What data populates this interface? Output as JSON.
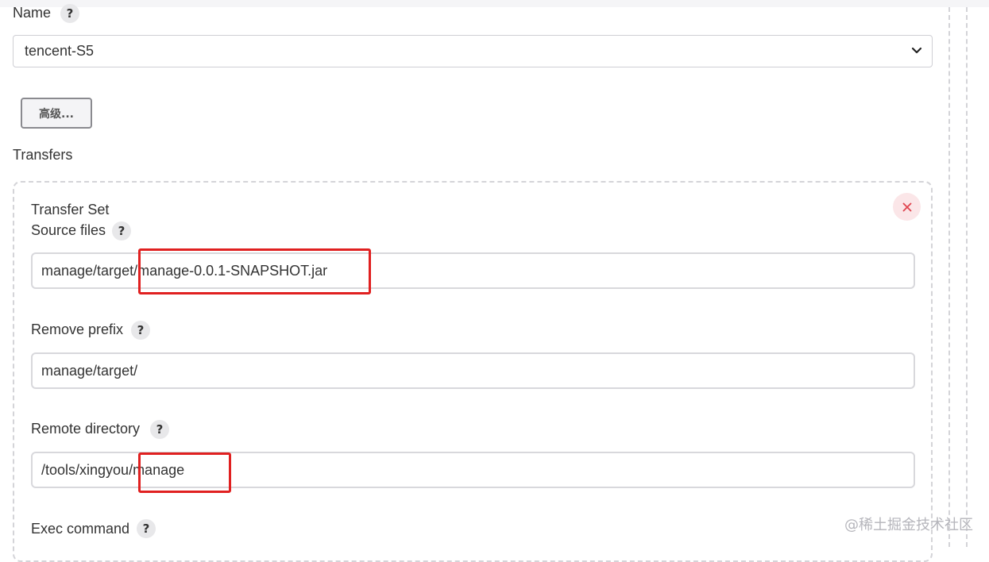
{
  "name_section": {
    "label": "Name",
    "help": "?",
    "selected": "tencent-S5"
  },
  "advanced_button": "高级...",
  "transfers": {
    "label": "Transfers",
    "set_title": "Transfer Set",
    "source_files": {
      "label": "Source files",
      "help": "?",
      "value": "manage/target/manage-0.0.1-SNAPSHOT.jar"
    },
    "remove_prefix": {
      "label": "Remove prefix",
      "help": "?",
      "value": "manage/target/"
    },
    "remote_directory": {
      "label": "Remote directory",
      "help": "?",
      "value": "/tools/xingyou/manage"
    },
    "exec_command": {
      "label": "Exec command",
      "help": "?"
    }
  },
  "watermark": "@稀土掘金技术社区",
  "colors": {
    "highlight": "#e02020",
    "close_icon": "#e0444f"
  }
}
